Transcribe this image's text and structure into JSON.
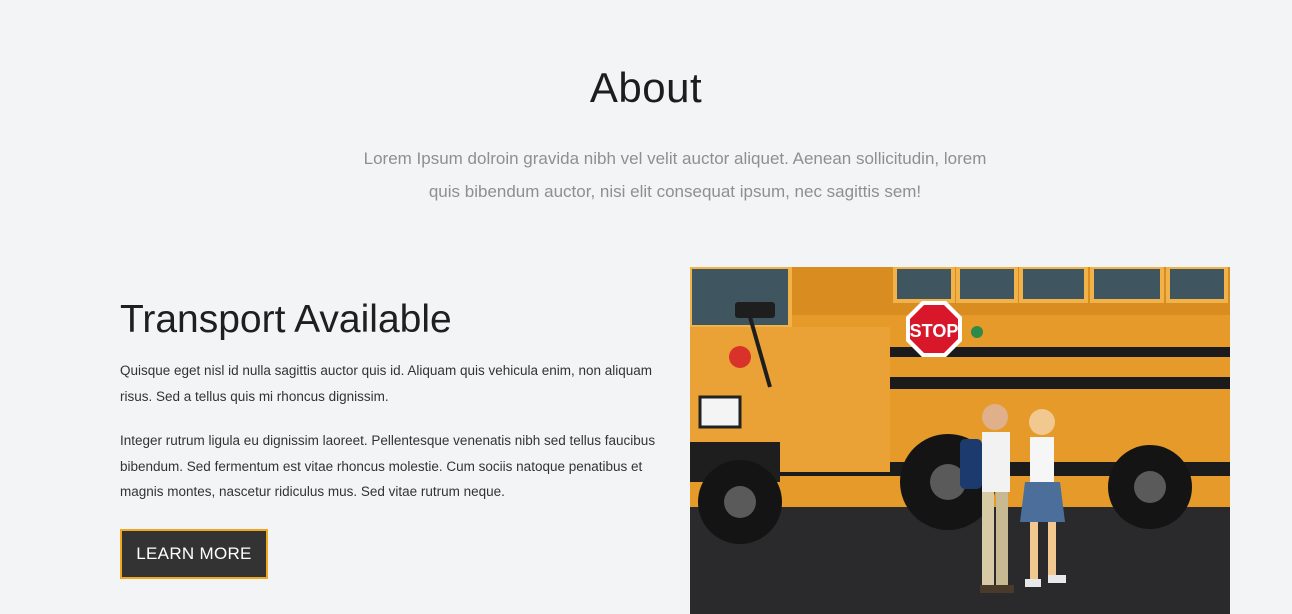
{
  "about": {
    "title": "About",
    "subtitle_line1": "Lorem Ipsum dolroin gravida nibh vel velit auctor aliquet. Aenean sollicitudin, lorem",
    "subtitle_line2": "quis bibendum auctor, nisi elit consequat ipsum, nec sagittis sem!"
  },
  "feature": {
    "heading": "Transport Available",
    "para1": "Quisque eget nisl id nulla sagittis auctor quis id. Aliquam quis vehicula enim, non aliquam risus. Sed a tellus quis mi rhoncus dignissim.",
    "para2": "Integer rutrum ligula eu dignissim laoreet. Pellentesque venenatis nibh sed tellus faucibus bibendum. Sed fermentum est vitae rhoncus molestie. Cum sociis natoque penatibus et magnis montes, nascetur ridiculus mus. Sed vitae rutrum neque.",
    "button_label": "LEARN MORE"
  },
  "image": {
    "sign_text": "STOP",
    "colors": {
      "bus": "#e69a2a",
      "stop_sign": "#d8182a",
      "road": "#2a2a2c",
      "button_border": "#f0a81f"
    }
  }
}
